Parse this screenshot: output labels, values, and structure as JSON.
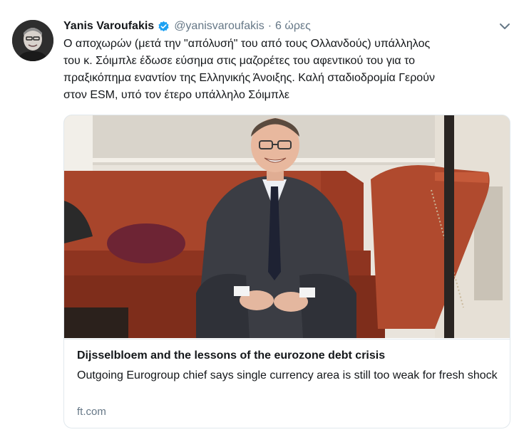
{
  "tweet": {
    "author_name": "Yanis Varoufakis",
    "handle": "@yanisvaroufakis",
    "separator": "·",
    "time": "6 ώρες",
    "text": "Ο αποχωρών (μετά την \"απόλυσή\" του από τους Ολλανδούς) υπάλληλος\nτου κ. Σόιμπλε έδωσε εύσημα στις μαζορέτες του αφεντικού του για το\nπραξικόπημα εναντίον της Ελληνικής Άνοιξης. Καλή σταδιοδρομία Γερούν\nστον ESM, υπό τον έτερο υπάλληλο Σόιμπλε",
    "verified_icon": "verified-badge-icon",
    "menu_icon": "chevron-down-icon"
  },
  "card": {
    "title": "Dijsselbloem and the lessons of the eurozone debt crisis",
    "description": "Outgoing Eurogroup chief says single currency area is still too weak for fresh shock",
    "domain": "ft.com"
  },
  "colors": {
    "text": "#14171a",
    "secondary": "#657786",
    "verified": "#1da1f2",
    "border": "#e1e8ed"
  }
}
